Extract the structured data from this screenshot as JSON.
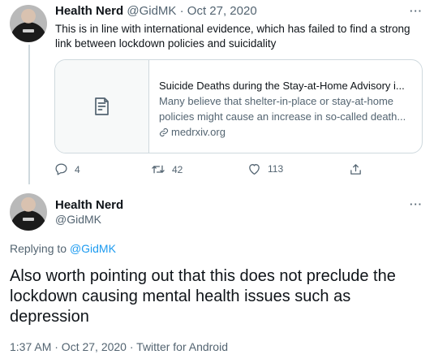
{
  "tweet1": {
    "display_name": "Health Nerd",
    "handle": "@GidMK",
    "separator": "·",
    "date": "Oct 27, 2020",
    "more": "···",
    "text": "This is in line with international evidence, which has failed to find a strong link between lockdown policies and suicidality",
    "card": {
      "title": "Suicide Deaths during the Stay-at-Home Advisory i...",
      "description": "Many believe that shelter-in-place or stay-at-home policies might cause an increase in so-called death...",
      "domain": "medrxiv.org",
      "media_icon": "document-icon"
    },
    "actions": {
      "reply_count": "4",
      "retweet_count": "42",
      "like_count": "113"
    }
  },
  "tweet2": {
    "display_name": "Health Nerd",
    "handle": "@GidMK",
    "more": "···",
    "replying_prefix": "Replying to",
    "replying_to": "@GidMK",
    "text": "Also worth pointing out that this does not preclude the lockdown causing mental health issues such as depression",
    "meta": "1:37 AM · Oct 27, 2020 · Twitter for Android"
  },
  "colors": {
    "text": "#0f1419",
    "muted": "#536471",
    "link": "#1d9bf0",
    "border": "#cfd9de"
  }
}
